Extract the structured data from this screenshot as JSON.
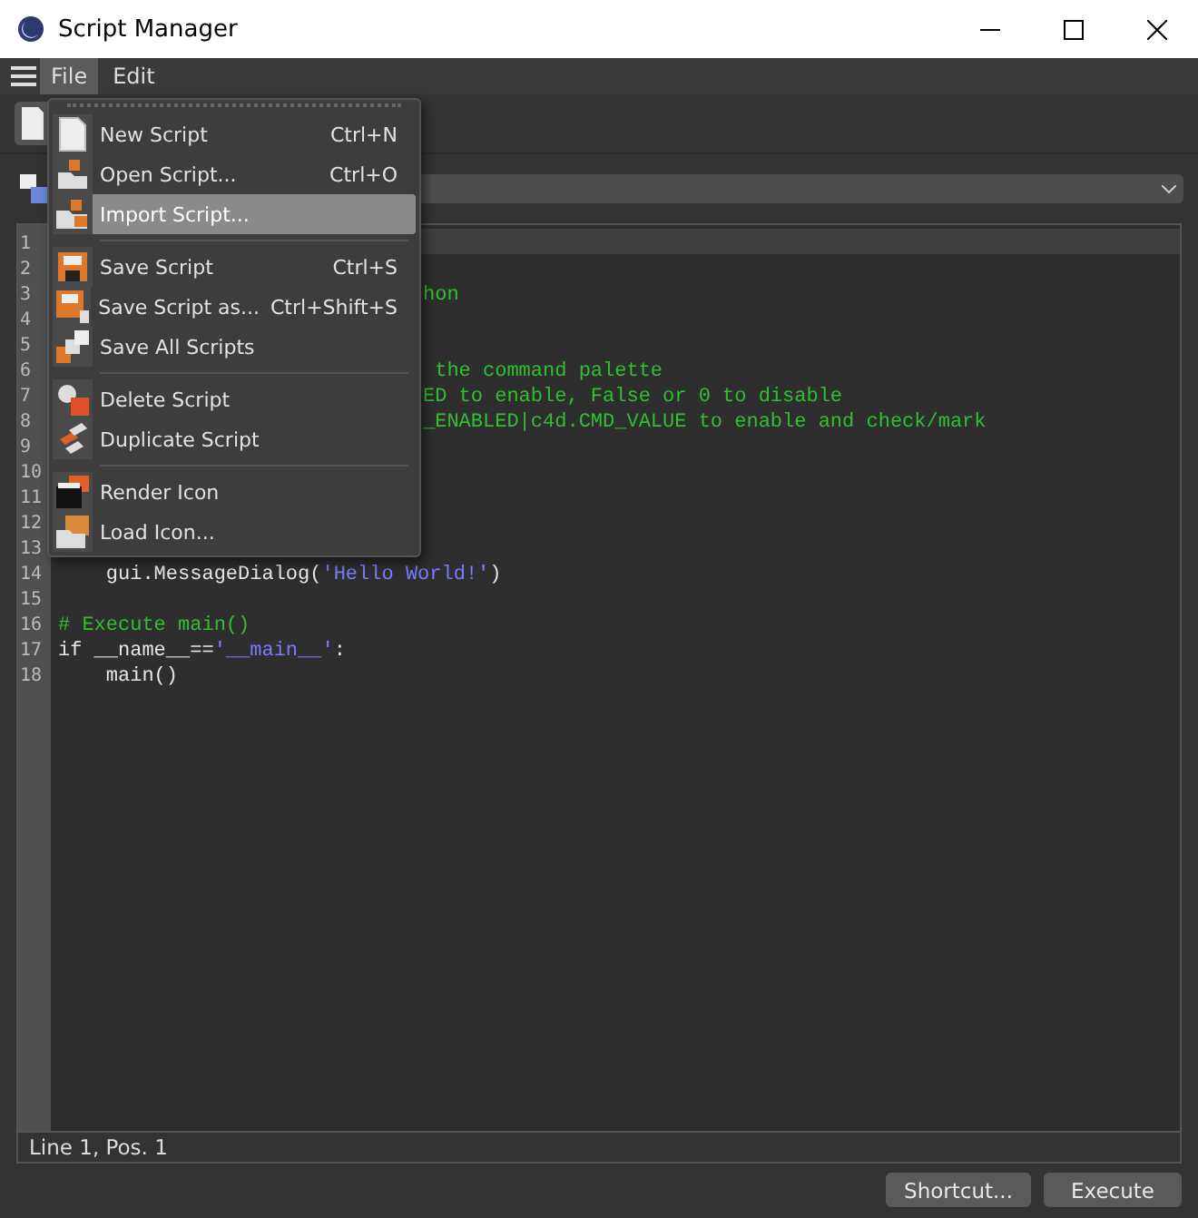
{
  "window": {
    "title": "Script Manager"
  },
  "menu_bar": [
    {
      "label": "File",
      "selected": true
    },
    {
      "label": "Edit",
      "selected": false
    }
  ],
  "file_menu": {
    "groups": [
      [
        {
          "label": "New Script",
          "shortcut": "Ctrl+N",
          "selected": false
        },
        {
          "label": "Open Script...",
          "shortcut": "Ctrl+O",
          "selected": false
        },
        {
          "label": "Import Script...",
          "selected": true
        }
      ],
      [
        {
          "label": "Save Script",
          "shortcut": "Ctrl+S",
          "selected": false
        },
        {
          "label": "Save Script as...",
          "shortcut": "Ctrl+Shift+S",
          "selected": false
        },
        {
          "label": "Save All Scripts",
          "selected": false
        }
      ],
      [
        {
          "label": "Delete Script",
          "selected": false
        },
        {
          "label": "Duplicate Script",
          "selected": false
        }
      ],
      [
        {
          "label": "Render Icon",
          "selected": false
        },
        {
          "label": "Load Icon...",
          "selected": false
        }
      ]
    ]
  },
  "editor": {
    "line_numbers": [
      "1",
      "2",
      "3",
      "4",
      "5",
      "6",
      "7",
      "8",
      "9",
      "10",
      "11",
      "12",
      "13",
      "14",
      "15",
      "16",
      "17",
      "18"
    ],
    "lines": [
      {
        "kind": "hidden"
      },
      {
        "kind": "hidden"
      },
      {
        "kind": "partial",
        "tokens": [
          {
            "kind": "comment",
            "text": "hon"
          }
        ]
      },
      {
        "kind": "hidden"
      },
      {
        "kind": "hidden"
      },
      {
        "kind": "partial",
        "tokens": [
          {
            "kind": "comment",
            "text": " the command palette"
          }
        ]
      },
      {
        "kind": "partial",
        "tokens": [
          {
            "kind": "comment",
            "text": "ED to enable, False or 0 to disable"
          }
        ]
      },
      {
        "kind": "partial",
        "tokens": [
          {
            "kind": "comment",
            "text": "_ENABLED|c4d.CMD_VALUE to enable and check/mark"
          }
        ]
      },
      {
        "kind": "hidden"
      },
      {
        "kind": "hidden"
      },
      {
        "kind": "hidden"
      },
      {
        "kind": "hidden"
      },
      {
        "kind": "hidden"
      },
      {
        "kind": "full",
        "tokens": [
          {
            "kind": "plain",
            "text": "    gui.MessageDialog("
          },
          {
            "kind": "string",
            "text": "'Hello World!'"
          },
          {
            "kind": "plain",
            "text": ")"
          }
        ]
      },
      {
        "kind": "blank"
      },
      {
        "kind": "full",
        "tokens": [
          {
            "kind": "comment",
            "text": "# Execute main()"
          }
        ]
      },
      {
        "kind": "full",
        "tokens": [
          {
            "kind": "plain",
            "text": "if __name__=="
          },
          {
            "kind": "string",
            "text": "'__main__'"
          },
          {
            "kind": "plain",
            "text": ":"
          }
        ]
      },
      {
        "kind": "full",
        "tokens": [
          {
            "kind": "plain",
            "text": "    main()"
          }
        ]
      }
    ]
  },
  "status_bar": {
    "text": "Line 1, Pos. 1"
  },
  "buttons": [
    "Shortcut...",
    "Execute"
  ]
}
